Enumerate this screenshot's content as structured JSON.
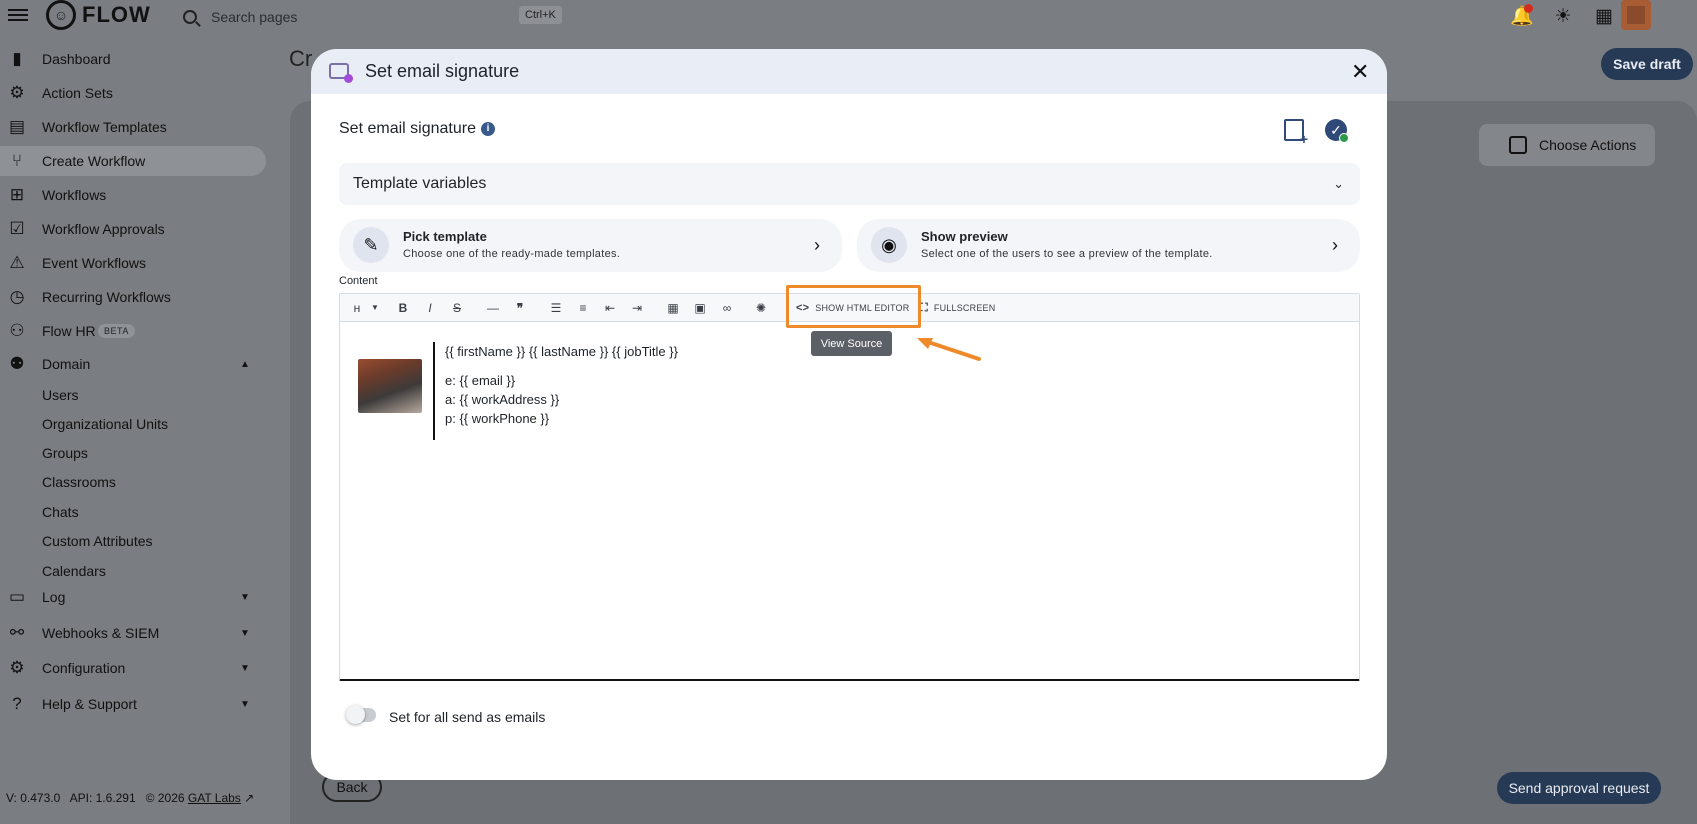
{
  "app": {
    "name": "FLOW"
  },
  "search": {
    "placeholder": "Search pages",
    "shortcut": "Ctrl+K"
  },
  "sidebar": {
    "items": [
      {
        "label": "Dashboard",
        "icon": "bar-chart-icon"
      },
      {
        "label": "Action Sets",
        "icon": "gears-icon"
      },
      {
        "label": "Workflow Templates",
        "icon": "template-icon"
      },
      {
        "label": "Create Workflow",
        "icon": "branch-icon"
      },
      {
        "label": "Workflows",
        "icon": "hierarchy-icon"
      },
      {
        "label": "Workflow Approvals",
        "icon": "approval-icon"
      },
      {
        "label": "Event Workflows",
        "icon": "alarm-icon"
      },
      {
        "label": "Recurring Workflows",
        "icon": "clock-icon"
      },
      {
        "label": "Flow HR",
        "icon": "people-tree-icon",
        "badge": "BETA"
      },
      {
        "label": "Domain",
        "icon": "group-icon"
      },
      {
        "label": "Log",
        "icon": "log-icon"
      },
      {
        "label": "Webhooks & SIEM",
        "icon": "webhook-icon"
      },
      {
        "label": "Configuration",
        "icon": "gear-icon"
      },
      {
        "label": "Help & Support",
        "icon": "help-icon"
      }
    ],
    "domain_sub": [
      "Users",
      "Organizational Units",
      "Groups",
      "Classrooms",
      "Chats",
      "Custom Attributes",
      "Calendars"
    ]
  },
  "footer": {
    "version": "V: 0.473.0",
    "api": "API: 1.6.291",
    "copyright": "© 2026",
    "link": "GAT Labs"
  },
  "background": {
    "title": "Cr",
    "save_draft": "Save draft",
    "choose_actions": "Choose Actions",
    "back": "Back",
    "send_approval": "Send approval request"
  },
  "modal": {
    "title": "Set email signature",
    "subtitle": "Set email signature",
    "template_variables": "Template variables",
    "pick_template": {
      "title": "Pick template",
      "desc": "Choose one of the ready-made templates."
    },
    "show_preview": {
      "title": "Show preview",
      "desc": "Select one of the users to see a preview of the template."
    },
    "content_label": "Content",
    "toolbar": {
      "html_editor": "SHOW HTML EDITOR",
      "fullscreen": "FULLSCREEN",
      "tooltip": "View Source"
    },
    "signature": {
      "line1": "{{ firstName }} {{ lastName }} {{ jobTitle }}",
      "line2": "e: {{ email }}",
      "line3": "a: {{ workAddress }}",
      "line4": "p: {{ workPhone }}"
    },
    "toggle_label": "Set for all send as emails"
  },
  "colors": {
    "accent": "#263a55",
    "highlight": "#ef8a2b",
    "overlay": "#7a7d82"
  }
}
